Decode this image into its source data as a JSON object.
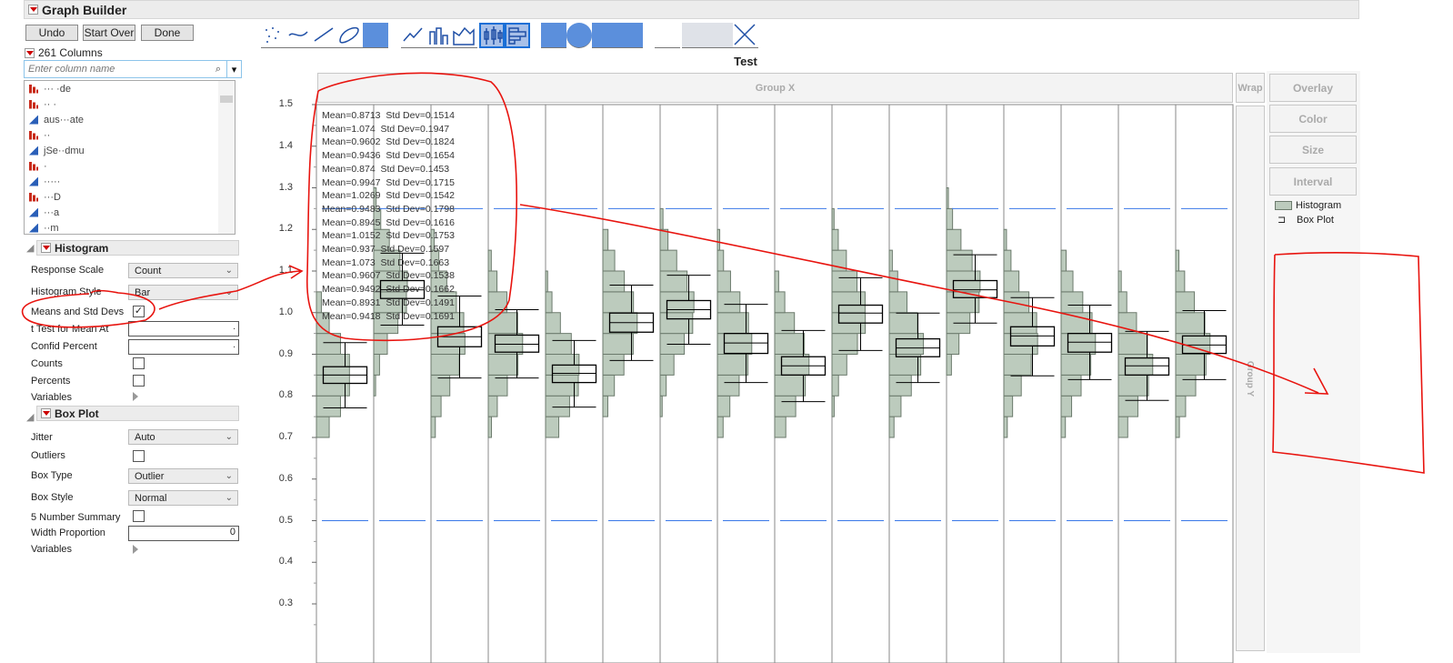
{
  "header": {
    "title": "Graph Builder"
  },
  "buttons": {
    "undo": "Undo",
    "start_over": "Start Over",
    "done": "Done"
  },
  "columns": {
    "count_label": "261 Columns",
    "search_placeholder": "Enter column name",
    "items": [
      {
        "type": "nominal",
        "name": "··· ·de"
      },
      {
        "type": "nominal",
        "name": "·· ·"
      },
      {
        "type": "continuous",
        "name": "aus···ate"
      },
      {
        "type": "nominal",
        "name": "··"
      },
      {
        "type": "continuous",
        "name": "jSe··dmu"
      },
      {
        "type": "nominal",
        "name": "·"
      },
      {
        "type": "continuous",
        "name": "·····"
      },
      {
        "type": "nominal",
        "name": "···D"
      },
      {
        "type": "continuous",
        "name": "···a"
      },
      {
        "type": "continuous",
        "name": "··m"
      }
    ]
  },
  "histogram_panel": {
    "title": "Histogram",
    "response_scale_label": "Response Scale",
    "response_scale": "Count",
    "style_label": "Histogram Style",
    "style": "Bar",
    "means_label": "Means and Std Devs",
    "means_checked": true,
    "ttest_label": "t Test for Mean At",
    "ttest_value": ".",
    "confid_label": "Confid Percent",
    "confid_value": ".",
    "counts_label": "Counts",
    "percents_label": "Percents",
    "variables_label": "Variables"
  },
  "boxplot_panel": {
    "title": "Box Plot",
    "jitter_label": "Jitter",
    "jitter": "Auto",
    "outliers_label": "Outliers",
    "box_type_label": "Box Type",
    "box_type": "Outlier",
    "box_style_label": "Box Style",
    "box_style": "Normal",
    "five_num_label": "5 Number Summary",
    "width_prop_label": "Width Proportion",
    "width_prop_value": "0",
    "variables_label": "Variables"
  },
  "toolbar": [
    "points",
    "smoother",
    "line-of-fit",
    "ellipse",
    "contour",
    "line",
    "bar",
    "area",
    "box-plot",
    "histogram",
    "heatmap",
    "pie",
    "treemap",
    "mosaic",
    "caption-box",
    "formula",
    "map-shapes",
    "parallel"
  ],
  "graph": {
    "title": "Test",
    "group_x": "Group X",
    "group_y": "Group Y",
    "wrap": "Wrap",
    "overlay": "Overlay",
    "color": "Color",
    "size": "Size",
    "interval": "Interval",
    "legend": [
      {
        "label": "Histogram"
      },
      {
        "label": "Box Plot"
      }
    ]
  },
  "colors": {
    "hist_fill": "#bccbbd",
    "hist_stroke": "#6b7a6c",
    "ref_line": "#3a78e8",
    "annotation": "#e8140f"
  },
  "chart_data": {
    "type": "histogram+boxplot",
    "title": "Test",
    "ylim": [
      0.25,
      1.55
    ],
    "yticks": [
      "0.3",
      "0.4",
      "0.5",
      "0.6",
      "0.7",
      "0.8",
      "0.9",
      "1.0",
      "1.1",
      "1.2",
      "1.3",
      "1.4",
      "1.5"
    ],
    "reference_lines": [
      0.5,
      1.25
    ],
    "means_text": [
      "Mean=0.8713  Std Dev=0.1514",
      "Mean=1.074  Std Dev=0.1947",
      "Mean=0.9602  Std Dev=0.1824",
      "Mean=0.9436  Std Dev=0.1654",
      "Mean=0.874  Std Dev=0.1453",
      "Mean=0.9947  Std Dev=0.1715",
      "Mean=1.0269  Std Dev=0.1542",
      "Mean=0.9483  Std Dev=0.1798",
      "Mean=0.8945  Std Dev=0.1616",
      "Mean=1.0152  Std Dev=0.1753",
      "Mean=0.937  Std Dev=0.1597",
      "Mean=1.073  Std Dev=0.1663",
      "Mean=0.9607  Std Dev=0.1538",
      "Mean=0.9492  Std Dev=0.1662",
      "Mean=0.8931  Std Dev=0.1491",
      "Mean=0.9418  Std Dev=0.1691"
    ],
    "groups": [
      {
        "wlo": 0.771,
        "q1": 0.83,
        "med": 0.85,
        "q3": 0.87,
        "whi": 0.928
      },
      {
        "wlo": 0.97,
        "q1": 1.034,
        "med": 1.055,
        "q3": 1.077,
        "whi": 1.143
      },
      {
        "wlo": 0.843,
        "q1": 0.918,
        "med": 0.942,
        "q3": 0.966,
        "whi": 1.04
      },
      {
        "wlo": 0.843,
        "q1": 0.905,
        "med": 0.924,
        "q3": 0.946,
        "whi": 1.007
      },
      {
        "wlo": 0.773,
        "q1": 0.832,
        "med": 0.854,
        "q3": 0.874,
        "whi": 0.933
      },
      {
        "wlo": 0.885,
        "q1": 0.953,
        "med": 0.976,
        "q3": 0.999,
        "whi": 1.066
      },
      {
        "wlo": 0.924,
        "q1": 0.985,
        "med": 1.007,
        "q3": 1.029,
        "whi": 1.09
      },
      {
        "wlo": 0.832,
        "q1": 0.902,
        "med": 0.927,
        "q3": 0.95,
        "whi": 1.02
      },
      {
        "wlo": 0.786,
        "q1": 0.85,
        "med": 0.872,
        "q3": 0.894,
        "whi": 0.957
      },
      {
        "wlo": 0.909,
        "q1": 0.975,
        "med": 0.999,
        "q3": 1.018,
        "whi": 1.084
      },
      {
        "wlo": 0.832,
        "q1": 0.894,
        "med": 0.915,
        "q3": 0.937,
        "whi": 0.999
      },
      {
        "wlo": 0.975,
        "q1": 1.036,
        "med": 1.055,
        "q3": 1.077,
        "whi": 1.139
      },
      {
        "wlo": 0.848,
        "q1": 0.92,
        "med": 0.944,
        "q3": 0.966,
        "whi": 1.036
      },
      {
        "wlo": 0.839,
        "q1": 0.905,
        "med": 0.929,
        "q3": 0.95,
        "whi": 1.018
      },
      {
        "wlo": 0.789,
        "q1": 0.85,
        "med": 0.872,
        "q3": 0.891,
        "whi": 0.955
      },
      {
        "wlo": 0.839,
        "q1": 0.902,
        "med": 0.922,
        "q3": 0.944,
        "whi": 1.005
      }
    ]
  }
}
